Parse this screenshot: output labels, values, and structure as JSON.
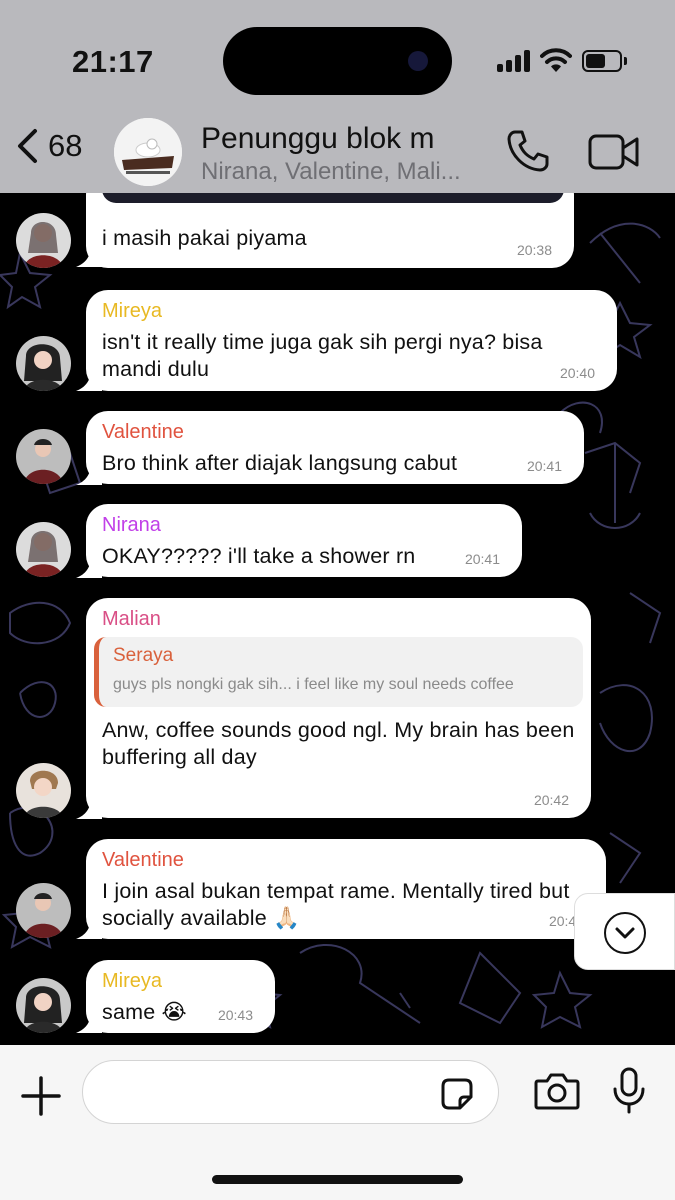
{
  "status": {
    "time": "21:17",
    "battery_level": 0.6
  },
  "header": {
    "back_count": "68",
    "title": "Penunggu blok m",
    "subtitle": "Nirana, Valentine, Mali..."
  },
  "colors": {
    "header_bg": "#b9b9bd",
    "chat_bg": "#000000",
    "bubble": "#ffffff",
    "mireya": "#e8b923",
    "valentine": "#e0533f",
    "nirana": "#c13fe8",
    "malian": "#d94f86",
    "seraya": "#d9613c"
  },
  "messages": [
    {
      "sender": "",
      "text": "i masih pakai piyama",
      "time": "20:38"
    },
    {
      "sender": "Mireya",
      "text": "isn't it really time juga gak sih pergi nya? bisa mandi dulu",
      "time": "20:40"
    },
    {
      "sender": "Valentine",
      "text": "Bro think after diajak langsung cabut",
      "time": "20:41"
    },
    {
      "sender": "Nirana",
      "text": "OKAY????? i'll take a shower rn",
      "time": "20:41"
    },
    {
      "sender": "Malian",
      "reply_to": "Seraya",
      "reply_text": "guys pls nongki gak sih... i feel like my soul needs coffee",
      "text": "Anw, coffee sounds good ngl. My brain has been buffering all day",
      "time": "20:42"
    },
    {
      "sender": "Valentine",
      "text": "I join asal bukan tempat rame. Mentally tired but socially available 🙏🏻",
      "time": "20:43"
    },
    {
      "sender": "Mireya",
      "text": "same 😭",
      "time": "20:43"
    }
  ],
  "icons": {
    "back": "chevron-left-icon",
    "call": "phone-icon",
    "video": "video-camera-icon",
    "scroll": "chevron-down-circle-icon",
    "attach": "plus-icon",
    "sticker": "sticker-icon",
    "camera": "camera-icon",
    "mic": "microphone-icon"
  },
  "input": {
    "placeholder": ""
  }
}
